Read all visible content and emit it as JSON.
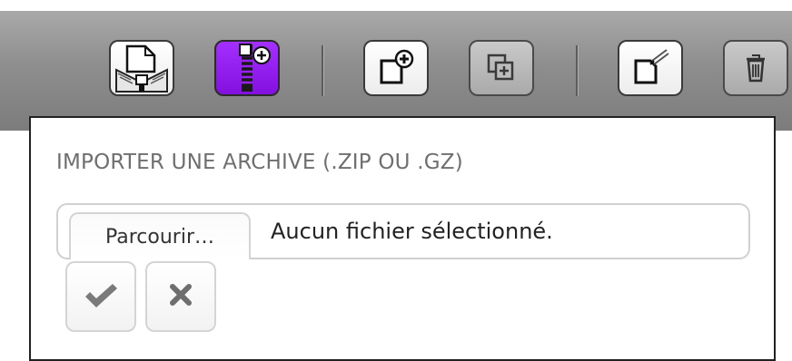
{
  "toolbar": {
    "buttons": [
      {
        "icon": "unzip-document-icon",
        "state": "enabled"
      },
      {
        "icon": "zip-archive-add-icon",
        "state": "active",
        "color": "#9a22f5"
      },
      {
        "icon": "new-document-icon",
        "state": "enabled"
      },
      {
        "icon": "duplicate-icon",
        "state": "disabled"
      },
      {
        "icon": "edit-document-icon",
        "state": "enabled"
      },
      {
        "icon": "trash-icon",
        "state": "disabled"
      }
    ]
  },
  "import_panel": {
    "title": "IMPORTER UNE ARCHIVE (.ZIP OU .GZ)",
    "file_input": {
      "browse_label": "Parcourir…",
      "status": "Aucun fichier sélectionné."
    },
    "actions": [
      {
        "icon": "checkmark-icon"
      },
      {
        "icon": "close-icon"
      }
    ]
  }
}
